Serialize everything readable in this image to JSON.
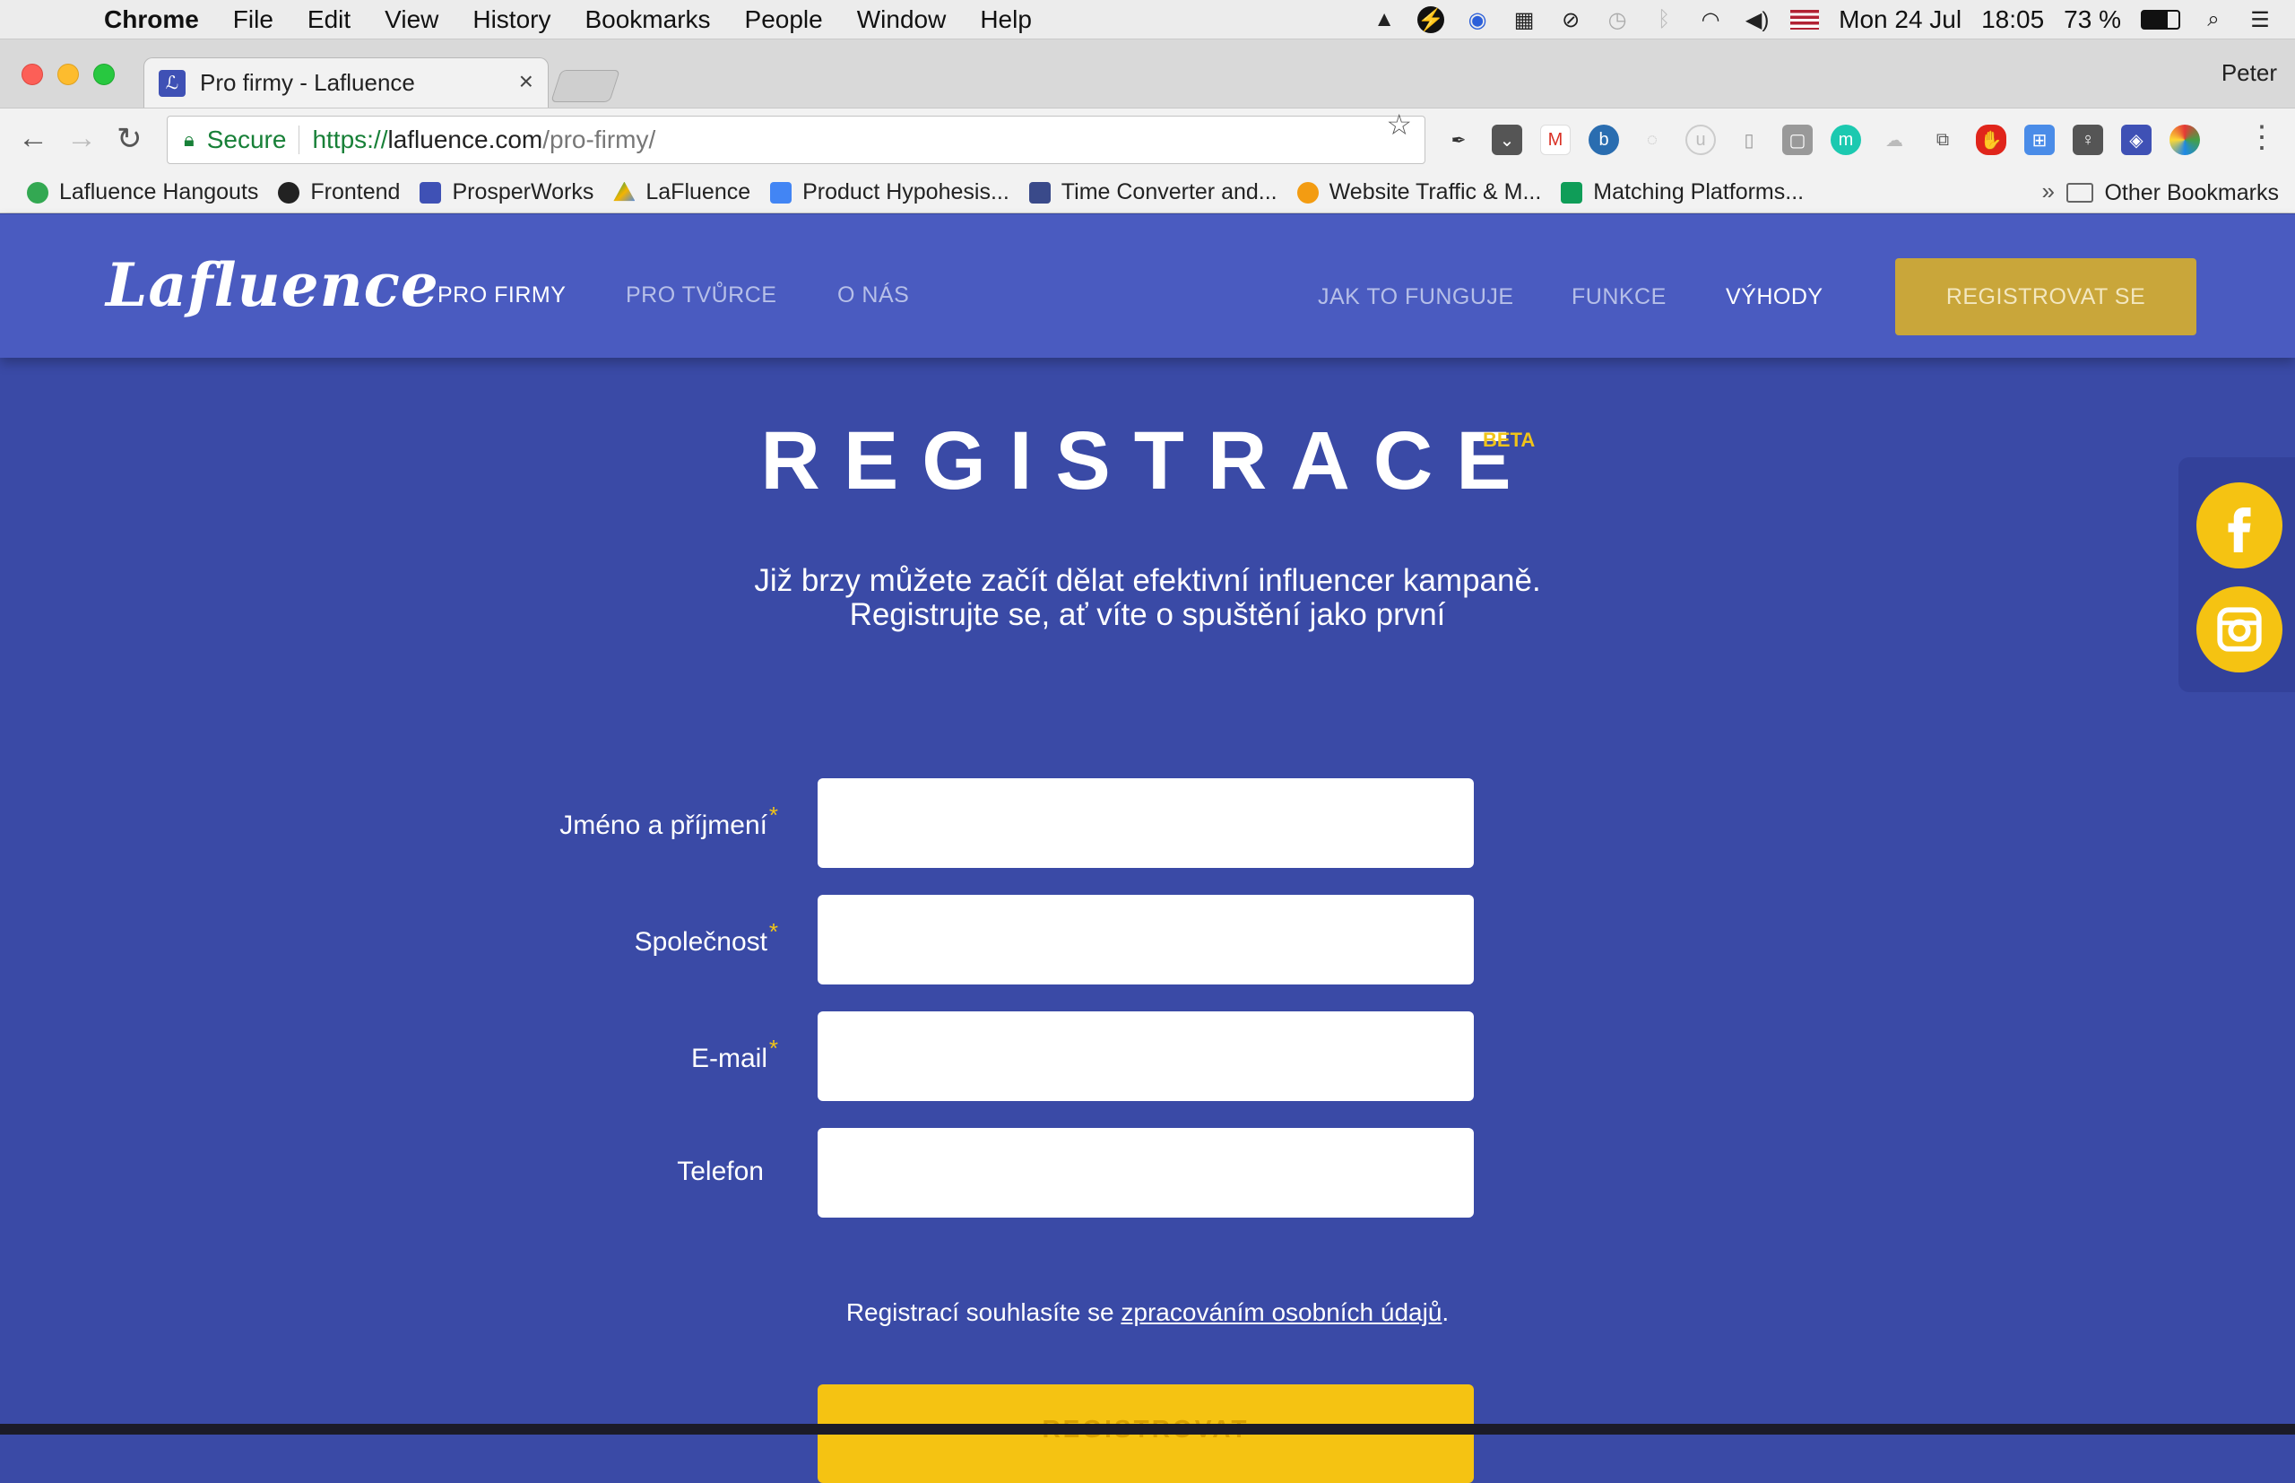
{
  "menubar": {
    "app": "Chrome",
    "items": [
      "File",
      "Edit",
      "View",
      "History",
      "Bookmarks",
      "People",
      "Window",
      "Help"
    ],
    "date": "Mon 24 Jul",
    "time": "18:05",
    "battery": "73 %"
  },
  "tab": {
    "title": "Pro firmy - Lafluence",
    "close": "×"
  },
  "profile": "Peter",
  "omnibox": {
    "secure": "Secure",
    "scheme": "https://",
    "host": "lafluence.com",
    "path": "/pro-firmy/"
  },
  "bookmarks": {
    "items": [
      {
        "label": "Lafluence Hangouts",
        "icon": "hangouts-icon",
        "color": "#33a852"
      },
      {
        "label": "Frontend",
        "icon": "github-icon",
        "color": "#222222"
      },
      {
        "label": "ProsperWorks",
        "icon": "prosperworks-icon",
        "color": "#3f51b5"
      },
      {
        "label": "LaFluence",
        "icon": "google-drive-icon",
        "color": "#f4b400"
      },
      {
        "label": "Product Hypohesis...",
        "icon": "google-docs-icon",
        "color": "#4285f4"
      },
      {
        "label": "Time Converter and...",
        "icon": "time-converter-icon",
        "color": "#3a4a8a"
      },
      {
        "label": "Website Traffic & M...",
        "icon": "similarweb-icon",
        "color": "#f39c12"
      },
      {
        "label": "Matching Platforms...",
        "icon": "google-sheets-icon",
        "color": "#0f9d58"
      }
    ],
    "more": "»",
    "other": "Other Bookmarks"
  },
  "site": {
    "logo": "Lafluence",
    "nav_left": [
      "PRO FIRMY",
      "PRO TVŮRCE",
      "O NÁS"
    ],
    "nav_right": [
      "JAK TO FUNGUJE",
      "FUNKCE",
      "VÝHODY"
    ],
    "cta": "REGISTROVAT SE",
    "title": "REGISTRACE",
    "beta": "BETA",
    "subtitle1": "Již brzy můžete začít dělat efektivní influencer kampaně.",
    "subtitle2": "Registrujte se, ať víte o spuštění jako první",
    "form": {
      "name_label": "Jméno a příjmení",
      "company_label": "Společnost",
      "email_label": "E-mail",
      "phone_label": "Telefon",
      "required_mark": "*"
    },
    "consent_text": "Registrací souhlasíte se ",
    "consent_link": "zpracováním osobních údajů",
    "consent_end": ".",
    "submit": "REGISTROVAT"
  },
  "social": [
    "facebook-icon",
    "instagram-icon"
  ],
  "colors": {
    "brand": "#3a4aa6",
    "nav": "#4a5bc0",
    "accent": "#f5c312",
    "cta": "#c9a63a"
  }
}
